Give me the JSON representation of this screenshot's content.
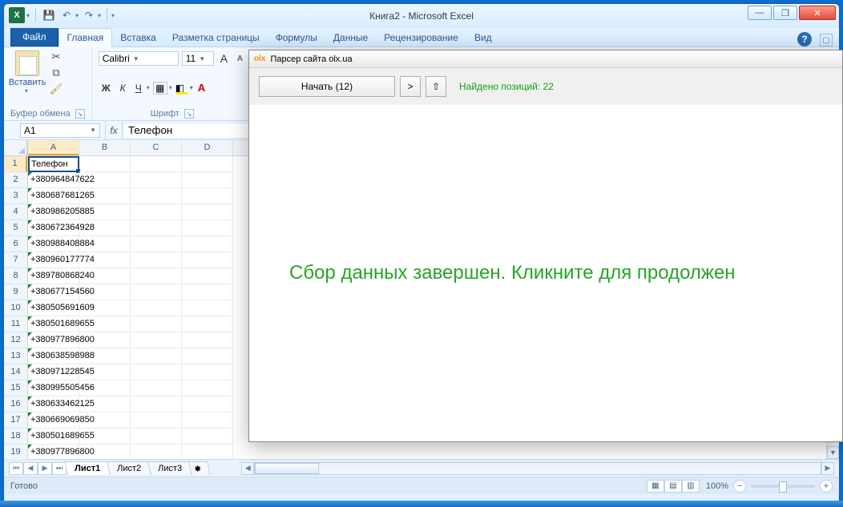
{
  "window": {
    "title": "Книга2  -  Microsoft Excel",
    "min": "—",
    "max": "❐",
    "close": "✕"
  },
  "qat": {
    "excel": "X"
  },
  "ribbon": {
    "file": "Файл",
    "tabs": [
      "Главная",
      "Вставка",
      "Разметка страницы",
      "Формулы",
      "Данные",
      "Рецензирование",
      "Вид"
    ],
    "clipboard": {
      "paste": "Вставить",
      "group": "Буфер обмена"
    },
    "font": {
      "name": "Calibri",
      "size": "11",
      "bold": "Ж",
      "italic": "К",
      "underline": "Ч",
      "grow": "A",
      "shrink": "A",
      "group": "Шрифт"
    }
  },
  "namebox": "A1",
  "fx_value": "Телефон",
  "columns": [
    "A",
    "B",
    "C",
    "D"
  ],
  "rows": [
    {
      "n": "1",
      "v": "Телефон",
      "sel": true
    },
    {
      "n": "2",
      "v": "+380964847622"
    },
    {
      "n": "3",
      "v": "+380687681265"
    },
    {
      "n": "4",
      "v": "+380986205885"
    },
    {
      "n": "5",
      "v": "+380672364928"
    },
    {
      "n": "6",
      "v": "+380988408884"
    },
    {
      "n": "7",
      "v": "+380960177774"
    },
    {
      "n": "8",
      "v": "+389780868240"
    },
    {
      "n": "9",
      "v": "+380677154560"
    },
    {
      "n": "10",
      "v": "+380505691609"
    },
    {
      "n": "11",
      "v": "+380501689655"
    },
    {
      "n": "12",
      "v": "+380977896800"
    },
    {
      "n": "13",
      "v": "+380638598988"
    },
    {
      "n": "14",
      "v": "+380971228545"
    },
    {
      "n": "15",
      "v": "+380995505456"
    },
    {
      "n": "16",
      "v": "+380633462125"
    },
    {
      "n": "17",
      "v": "+380669069850"
    },
    {
      "n": "18",
      "v": "+380501689655"
    },
    {
      "n": "19",
      "v": "+380977896800"
    }
  ],
  "sheets": [
    "Лист1",
    "Лист2",
    "Лист3"
  ],
  "status": {
    "ready": "Готово",
    "zoom": "100%"
  },
  "parser": {
    "title_prefix": "olx",
    "title": "Парсер сайта olx.ua",
    "start": "Начать (12)",
    "next": ">",
    "up": "⇧",
    "found": "Найдено позиций: 22",
    "message": "Сбор данных завершен. Кликните для продолжен"
  }
}
